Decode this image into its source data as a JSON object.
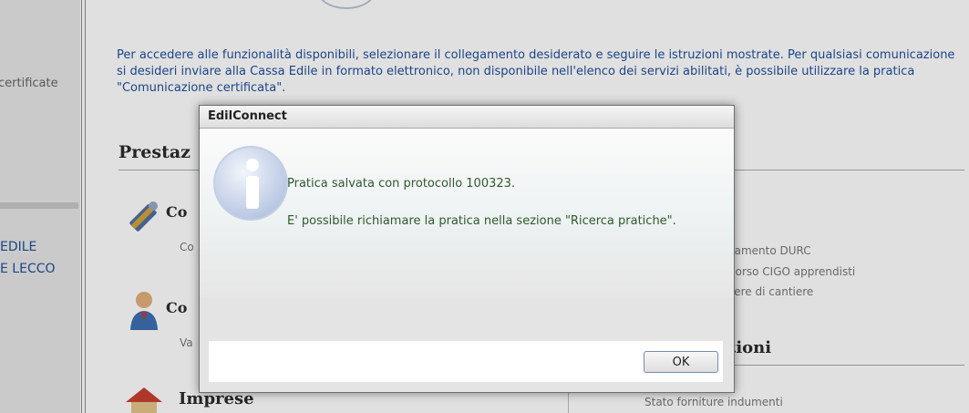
{
  "sidebar": {
    "partial_item": "certificate",
    "links": [
      "EDILE",
      "E LECCO"
    ]
  },
  "main": {
    "intro": "Per accedere alle funzionalità disponibili, selezionare il collegamento desiderato e seguire le istruzioni mostrate. Per qualsiasi comunicazione si desideri inviare alla Cassa Edile in formato elettronico, non disponibile nell'elenco dei servizi abilitati, è possibile utilizzare la pratica \"Comunicazione certificata\".",
    "section_prestazioni": "Prestaz",
    "item1_title": "Co",
    "item1_sub": "Co",
    "item2_title": "Co",
    "item2_sub": "Va",
    "item3_title": "Imprese",
    "right_items": [
      "camento DURC",
      "borso CIGO apprendisti",
      "sere di cantiere"
    ],
    "right_section_title": "tioni",
    "right_bottom_item": "Stato forniture indumenti",
    "right_partial_o": "o"
  },
  "dialog": {
    "title": "EdilConnect",
    "message_line1": "Pratica salvata con protocollo 100323.",
    "message_line2": "E' possibile richiamare la pratica nella sezione \"Ricerca pratiche\".",
    "ok_label": "OK",
    "icon": "info-icon"
  },
  "colors": {
    "link_blue": "#1f4f9b",
    "message_green": "#2e5a2e"
  }
}
